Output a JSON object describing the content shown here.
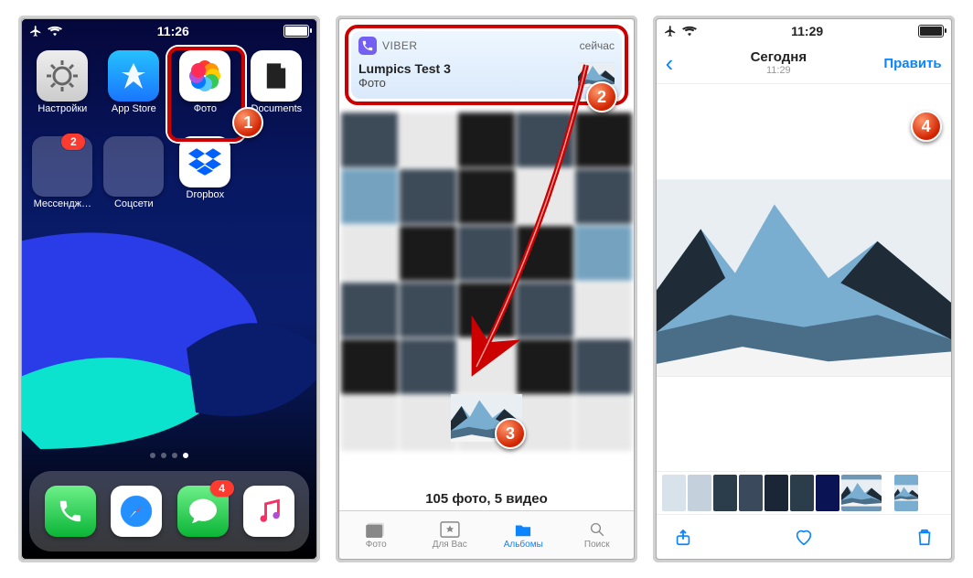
{
  "screen1": {
    "time": "11:26",
    "apps": {
      "settings": "Настройки",
      "appstore": "App Store",
      "photos": "Фото",
      "documents": "Documents",
      "messengers": "Мессендж…",
      "social": "Соцсети",
      "dropbox": "Dropbox"
    },
    "badges": {
      "messengers": "2",
      "messages": "4"
    }
  },
  "screen2": {
    "notif": {
      "app": "VIBER",
      "time": "сейчас",
      "title": "Lumpics Test 3",
      "subtitle": "Фото"
    },
    "caption": "105 фото, 5 видео",
    "tabs": {
      "photos": "Фото",
      "foryou": "Для Вас",
      "albums": "Альбомы",
      "search": "Поиск"
    }
  },
  "screen3": {
    "time": "11:29",
    "nav": {
      "title": "Сегодня",
      "sub": "11:29",
      "edit": "Править"
    }
  },
  "markers": {
    "1": "1",
    "2": "2",
    "3": "3",
    "4": "4"
  }
}
